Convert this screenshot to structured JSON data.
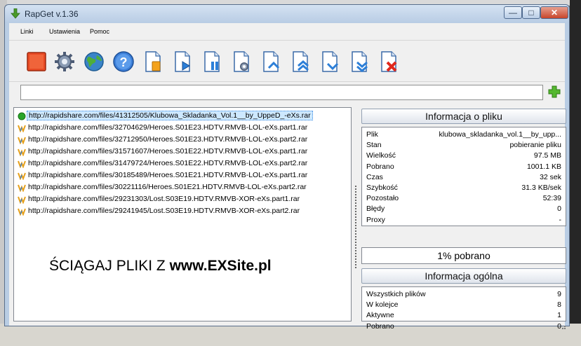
{
  "window": {
    "title": "RapGet v.1.36"
  },
  "menu": [
    "Linki",
    "Ustawienia",
    "Pomoc"
  ],
  "toolbar": [
    {
      "name": "stop-button",
      "icon": "stop-square-icon"
    },
    {
      "name": "settings-button",
      "icon": "gear-icon"
    },
    {
      "name": "internet-button",
      "icon": "globe-icon"
    },
    {
      "name": "help-button",
      "icon": "question-icon"
    },
    {
      "name": "paste-links-button",
      "icon": "doc-paste-icon"
    },
    {
      "name": "start-button",
      "icon": "doc-play-icon"
    },
    {
      "name": "pause-button",
      "icon": "doc-pause-icon"
    },
    {
      "name": "item-settings-button",
      "icon": "doc-gear-icon"
    },
    {
      "name": "move-up-button",
      "icon": "doc-up-icon"
    },
    {
      "name": "move-top-button",
      "icon": "doc-top-icon"
    },
    {
      "name": "move-down-button",
      "icon": "doc-down-icon"
    },
    {
      "name": "move-bottom-button",
      "icon": "doc-bottom-icon"
    },
    {
      "name": "delete-button",
      "icon": "doc-delete-icon"
    }
  ],
  "url_input": {
    "value": ""
  },
  "files": [
    {
      "url": "http://rapidshare.com/files/41312505/Klubowa_Skladanka_Vol.1__by_UppeD_-eXs.rar",
      "status": "active"
    },
    {
      "url": "http://rapidshare.com/files/32704629/Heroes.S01E23.HDTV.RMVB-LOL-eXs.part1.rar",
      "status": "waiting"
    },
    {
      "url": "http://rapidshare.com/files/32712950/Heroes.S01E23.HDTV.RMVB-LOL-eXs.part2.rar",
      "status": "waiting"
    },
    {
      "url": "http://rapidshare.com/files/31571607/Heroes.S01E22.HDTV.RMVB-LOL-eXs.part1.rar",
      "status": "waiting"
    },
    {
      "url": "http://rapidshare.com/files/31479724/Heroes.S01E22.HDTV.RMVB-LOL-eXs.part2.rar",
      "status": "waiting"
    },
    {
      "url": "http://rapidshare.com/files/30185489/Heroes.S01E21.HDTV.RMVB-LOL-eXs.part1.rar",
      "status": "waiting"
    },
    {
      "url": "http://rapidshare.com/files/30221116/Heroes.S01E21.HDTV.RMVB-LOL-eXs.part2.rar",
      "status": "waiting"
    },
    {
      "url": "http://rapidshare.com/files/29231303/Lost.S03E19.HDTV.RMVB-XOR-eXs.part1.rar",
      "status": "waiting"
    },
    {
      "url": "http://rapidshare.com/files/29241945/Lost.S03E19.HDTV.RMVB-XOR-eXs.part2.rar",
      "status": "waiting"
    }
  ],
  "promo": {
    "prefix": "ŚCIĄGAJ PLIKI Z ",
    "site": "www.EXSite.pl"
  },
  "file_info": {
    "title": "Informacja o pliku",
    "rows": [
      {
        "k": "Plik",
        "v": "klubowa_skladanka_vol.1__by_upp..."
      },
      {
        "k": "Stan",
        "v": "pobieranie pliku"
      },
      {
        "k": "Wielkość",
        "v": "97.5 MB"
      },
      {
        "k": "Pobrano",
        "v": "1001.1 KB"
      },
      {
        "k": "Czas",
        "v": "32 sek"
      },
      {
        "k": "Szybkość",
        "v": "31.3 KB/sek"
      },
      {
        "k": "Pozostało",
        "v": "52:39"
      },
      {
        "k": "Błędy",
        "v": "0"
      },
      {
        "k": "Proxy",
        "v": "-"
      }
    ]
  },
  "progress": {
    "label": "1% pobrano",
    "percent": 1
  },
  "general_info": {
    "title": "Informacja ogólna",
    "rows": [
      {
        "k": "Wszystkich plików",
        "v": "9"
      },
      {
        "k": "W kolejce",
        "v": "8"
      },
      {
        "k": "Aktywne",
        "v": "1"
      },
      {
        "k": "Pobrano",
        "v": "0"
      }
    ]
  },
  "colors": {
    "accent": "#3b8be0",
    "active_dot": "#2aa52a",
    "stop_red": "#e23b1f"
  }
}
